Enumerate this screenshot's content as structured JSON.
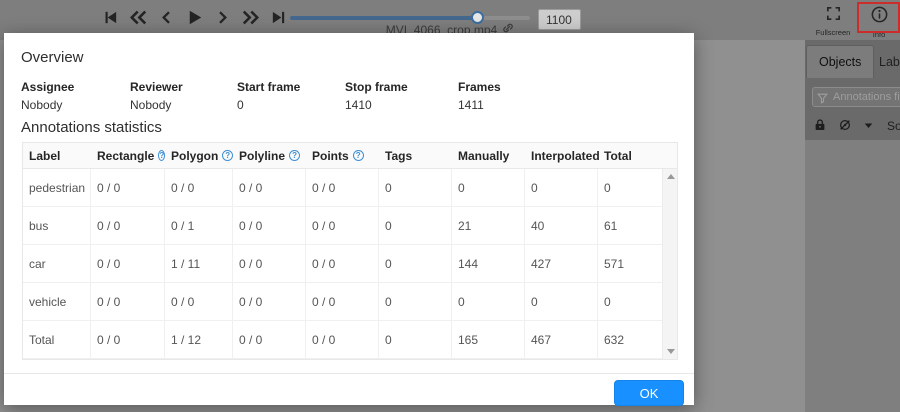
{
  "player": {
    "controls": [
      {
        "name": "first-frame"
      },
      {
        "name": "backward-jump"
      },
      {
        "name": "previous-frame"
      },
      {
        "name": "play"
      },
      {
        "name": "next-frame"
      },
      {
        "name": "forward-jump"
      },
      {
        "name": "last-frame"
      }
    ],
    "filename": "MVI_4066_crop.mp4",
    "frame_number": "1100",
    "slider": {
      "min": 0,
      "max": 1410,
      "value": 1100
    }
  },
  "header_right": {
    "fullscreen_label": "Fullscreen",
    "info_label": "Info"
  },
  "sidebar": {
    "tabs": [
      {
        "label": "Objects",
        "active": true
      },
      {
        "label": "Labels",
        "active": false
      }
    ],
    "filter_placeholder": "Annotations filter",
    "sort_label": "So"
  },
  "modal": {
    "overview_title": "Overview",
    "fields": [
      {
        "label": "Assignee",
        "value": "Nobody"
      },
      {
        "label": "Reviewer",
        "value": "Nobody"
      },
      {
        "label": "Start frame",
        "value": "0"
      },
      {
        "label": "Stop frame",
        "value": "1410"
      },
      {
        "label": "Frames",
        "value": "1411"
      }
    ],
    "stats_title": "Annotations statistics",
    "table": {
      "columns": [
        {
          "label": "Label",
          "help": false
        },
        {
          "label": "Rectangle",
          "help": true
        },
        {
          "label": "Polygon",
          "help": true
        },
        {
          "label": "Polyline",
          "help": true
        },
        {
          "label": "Points",
          "help": true
        },
        {
          "label": "Tags",
          "help": false
        },
        {
          "label": "Manually",
          "help": false
        },
        {
          "label": "Interpolated",
          "help": false
        },
        {
          "label": "Total",
          "help": false
        }
      ],
      "rows": [
        {
          "cells": [
            "pedestrian",
            "0 / 0",
            "0 / 0",
            "0 / 0",
            "0 / 0",
            "0",
            "0",
            "0",
            "0"
          ]
        },
        {
          "cells": [
            "bus",
            "0 / 0",
            "0 / 1",
            "0 / 0",
            "0 / 0",
            "0",
            "21",
            "40",
            "61"
          ]
        },
        {
          "cells": [
            "car",
            "0 / 0",
            "1 / 11",
            "0 / 0",
            "0 / 0",
            "0",
            "144",
            "427",
            "571"
          ]
        },
        {
          "cells": [
            "vehicle",
            "0 / 0",
            "0 / 0",
            "0 / 0",
            "0 / 0",
            "0",
            "0",
            "0",
            "0"
          ]
        },
        {
          "cells": [
            "Total",
            "0 / 0",
            "1 / 12",
            "0 / 0",
            "0 / 0",
            "0",
            "165",
            "467",
            "632"
          ]
        }
      ]
    },
    "ok_label": "OK",
    "help_question_mark": "?"
  },
  "colors": {
    "accent_blue": "#1890ff",
    "help_icon_blue": "#3d8fd6",
    "highlight_red": "#cb2d2d",
    "modal_bg": "#ffffff"
  }
}
